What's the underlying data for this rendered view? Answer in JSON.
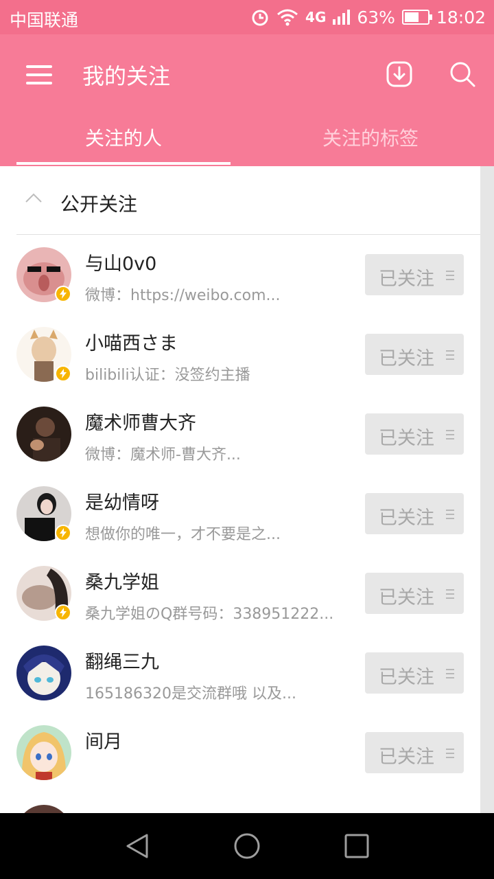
{
  "status_bar": {
    "carrier": "中国联通",
    "network": "4G",
    "battery": "63%",
    "battery_level": 0.63,
    "time": "18:02"
  },
  "app_bar": {
    "title": "我的关注",
    "icons": [
      "menu-icon",
      "download-icon",
      "search-icon"
    ]
  },
  "tabs": [
    {
      "label": "关注的人",
      "active": true
    },
    {
      "label": "关注的标签",
      "active": false
    }
  ],
  "section": {
    "title": "公开关注"
  },
  "follow_list": [
    {
      "name": "与山0v0",
      "desc": "微博：https://weibo.com...",
      "button": "已关注",
      "verified": true,
      "avatar_color": "#d98f8f"
    },
    {
      "name": "小喵西さま",
      "desc": "bilibili认证：没签约主播",
      "button": "已关注",
      "verified": true,
      "avatar_color": "#e8c9a7"
    },
    {
      "name": "魔术师曹大齐",
      "desc": "微博：魔术师-曹大齐...",
      "button": "已关注",
      "verified": false,
      "avatar_color": "#6b4a3a"
    },
    {
      "name": "是幼情呀",
      "desc": "想做你的唯一，才不要是之...",
      "button": "已关注",
      "verified": true,
      "avatar_color": "#cfc9c6"
    },
    {
      "name": "桑九学姐",
      "desc": "桑九学姐のQ群号码：338951222...",
      "button": "已关注",
      "verified": true,
      "avatar_color": "#b59b8e"
    },
    {
      "name": "翻绳三九",
      "desc": "165186320是交流群哦 以及...",
      "button": "已关注",
      "verified": false,
      "avatar_color": "#2e3a8c"
    },
    {
      "name": "间月",
      "desc": "",
      "button": "已关注",
      "verified": false,
      "avatar_color": "#f1c46a"
    }
  ],
  "colors": {
    "accent": "#f77b97",
    "status_bar": "#f36f8c",
    "badge": "#f7b500"
  }
}
